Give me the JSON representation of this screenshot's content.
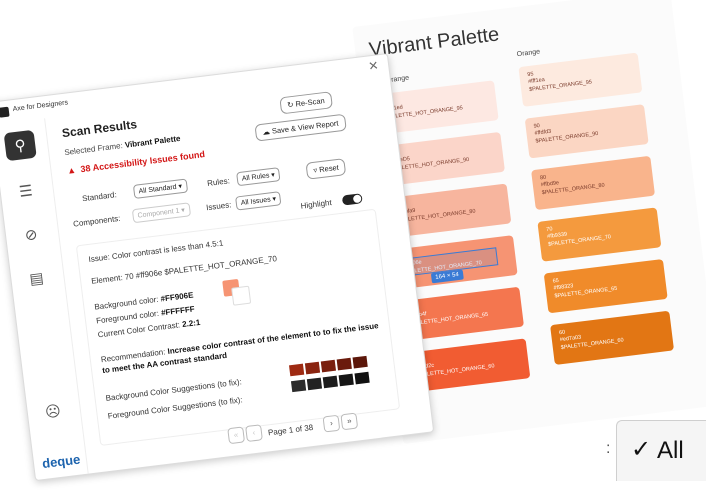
{
  "palette": {
    "title": "Vibrant Palette",
    "columns": [
      {
        "label": "Hot Orange",
        "swatches": [
          {
            "num": "95",
            "hex": "#fef1ed",
            "name": "$PALETTE_HOT_ORANGE_95",
            "color": "#fde8e2",
            "dark": false
          },
          {
            "num": "90",
            "hex": "#ffdeD5",
            "name": "$PALETTE_HOT_ORANGE_90",
            "color": "#fbd5c9",
            "dark": false
          },
          {
            "num": "80",
            "hex": "#febfa9",
            "name": "$PALETTE_HOT_ORANGE_80",
            "color": "#f7b59e",
            "dark": false
          },
          {
            "num": "70",
            "hex": "#ff906e",
            "name": "$PALETTE_HOT_ORANGE_70",
            "color": "#f69473",
            "dark": true
          },
          {
            "num": "65",
            "hex": "#ff7b4f",
            "name": "$PALETTE_HOT_ORANGE_65",
            "color": "#f4764f",
            "dark": true
          },
          {
            "num": "60",
            "hex": "#ff5d2c",
            "name": "$PALETTE_HOT_ORANGE_60",
            "color": "#f15c32",
            "dark": true
          }
        ]
      },
      {
        "label": "Orange",
        "swatches": [
          {
            "num": "95",
            "hex": "#fff1ea",
            "name": "$PALETTE_ORANGE_95",
            "color": "#fdeadf",
            "dark": false
          },
          {
            "num": "90",
            "hex": "#ffdfd3",
            "name": "$PALETTE_ORANGE_90",
            "color": "#fbd6c3",
            "dark": false
          },
          {
            "num": "80",
            "hex": "#ffbd9e",
            "name": "$PALETTE_ORANGE_80",
            "color": "#f9b48c",
            "dark": false
          },
          {
            "num": "70",
            "hex": "#fb9339",
            "name": "$PALETTE_ORANGE_70",
            "color": "#f49a3e",
            "dark": true
          },
          {
            "num": "65",
            "hex": "#f98323",
            "name": "$PALETTE_ORANGE_65",
            "color": "#f08b2a",
            "dark": true
          },
          {
            "num": "60",
            "hex": "#ed7a03",
            "name": "$PALETTE_ORANGE_60",
            "color": "#e27614",
            "dark": true
          }
        ]
      }
    ],
    "selection_size": "164 × 54"
  },
  "plugin": {
    "app_title": "Axe for Designers",
    "close_icon": "close-icon",
    "rail": [
      "scan-icon",
      "list-icon",
      "eye-off-icon",
      "comment-icon",
      "face-icon"
    ],
    "brand": "deque",
    "heading": "Scan Results",
    "rescan_label": "Re-Scan",
    "save_report_label": "Save & View Report",
    "frame_label": "Selected Frame:",
    "frame_name": "Vibrant Palette",
    "issues_count_text": "38 Accessibility Issues found",
    "standard_label": "Standard:",
    "standard_value": "All Standard",
    "rules_label": "Rules:",
    "rules_value": "All Rules",
    "reset_label": "Reset",
    "components_label": "Components:",
    "components_value": "Component 1",
    "issues_label": "Issues:",
    "issues_value": "All Issues",
    "highlight_label": "Highlight",
    "issue_text": "Issue: Color contrast is less than 4.5:1",
    "element_text": "Element: 70 #ff906e $PALETTE_HOT_ORANGE_70",
    "bg_label": "Background color:",
    "bg_value": "#FF906E",
    "fg_label": "Foreground color:",
    "fg_value": "#FFFFFF",
    "contrast_label": "Current Color Contrast:",
    "contrast_value": "2.2:1",
    "rec_label": "Recommendation:",
    "rec_text": "Increase color contrast of the element to to fix the issue to meet the AA contrast standard",
    "bg_suggest_label": "Background Color Suggestions (to fix):",
    "fg_suggest_label": "Foreground Color Suggestions (to fix):",
    "bg_suggestions": [
      "#9e2a12",
      "#8a2410",
      "#7a1f0e",
      "#6b1b0c",
      "#5c170a"
    ],
    "fg_suggestions": [
      "#2b2b2b",
      "#222222",
      "#1c1c1c",
      "#161616",
      "#111111"
    ],
    "page_text": "Page 1 of 38"
  },
  "dropdown_crop": {
    "option": "All"
  }
}
